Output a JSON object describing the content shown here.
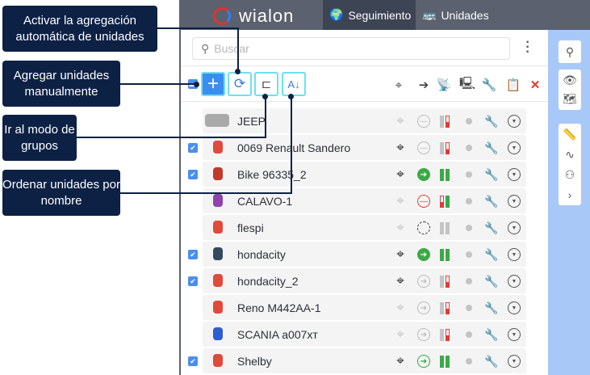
{
  "header": {
    "logo_text": "wialon",
    "tabs": [
      {
        "label": "Seguimiento",
        "icon": "globe-icon",
        "active": true
      },
      {
        "label": "Unidades",
        "icon": "bus-icon",
        "active": false
      }
    ]
  },
  "search": {
    "placeholder": "Buscar",
    "value": ""
  },
  "toolbar": {
    "buttons": [
      {
        "name": "add-units",
        "icon": "plus-icon"
      },
      {
        "name": "auto-add",
        "icon": "refresh-icon"
      },
      {
        "name": "groups-mode",
        "icon": "tree-icon"
      },
      {
        "name": "sort-by-name",
        "icon": "sort-az-icon",
        "label": "A↓"
      }
    ],
    "column_icons": [
      "crosshair-icon",
      "arrow-circle-icon",
      "satellite-icon",
      "network-icon",
      "wrench-icon",
      "clipboard-icon",
      "close-icon"
    ]
  },
  "units": [
    {
      "name": "JEEP",
      "checked": false,
      "icon_color": "#aaaaaa",
      "crosshair": "dim",
      "status": "stop-gray",
      "bars": [
        "gray",
        "red-low"
      ]
    },
    {
      "name": "0069 Renault Sandero",
      "checked": true,
      "icon_color": "#e04a3a",
      "crosshair": "on",
      "status": "stop-gray",
      "bars": [
        "gray",
        "red-low"
      ]
    },
    {
      "name": "Bike 96335_2",
      "checked": true,
      "icon_color": "#c0392b",
      "crosshair": "on",
      "status": "move-green",
      "bars": [
        "green",
        "green"
      ]
    },
    {
      "name": "CALAVO-1",
      "checked": false,
      "icon_color": "#8e44ad",
      "crosshair": "dim",
      "status": "stop-red",
      "bars": [
        "red-low",
        "green"
      ]
    },
    {
      "name": "flespi",
      "checked": false,
      "icon_color": "#e04a3a",
      "crosshair": "dim",
      "status": "none",
      "bars": [
        "gray",
        "gray"
      ]
    },
    {
      "name": "hondacity",
      "checked": true,
      "icon_color": "#34495e",
      "crosshair": "on",
      "status": "move-green",
      "bars": [
        "green",
        "green"
      ]
    },
    {
      "name": "hondacity_2",
      "checked": true,
      "icon_color": "#e04a3a",
      "crosshair": "on",
      "status": "arrow-gray",
      "bars": [
        "gray",
        "red-low"
      ]
    },
    {
      "name": "Reno M442AA-1",
      "checked": false,
      "icon_color": "#e04a3a",
      "crosshair": "dim",
      "status": "arrow-gray",
      "bars": [
        "gray",
        "red-low"
      ]
    },
    {
      "name": "SCANIA a007xт",
      "checked": false,
      "icon_color": "#2d5fd0",
      "crosshair": "dim",
      "status": "arrow-gray",
      "bars": [
        "gray",
        "red-low"
      ]
    },
    {
      "name": "Shelby",
      "checked": true,
      "icon_color": "#e04a3a",
      "crosshair": "on",
      "status": "arrow-green",
      "bars": [
        "green",
        "green"
      ]
    }
  ],
  "callouts": {
    "auto_add": "Activar la agregación automática de unidades",
    "add_manual": "Agregar unidades manualmente",
    "groups": "Ir al modo de grupos",
    "sort": "Ordenar unidades por nombre"
  },
  "colors": {
    "header": "#5b616e",
    "accent": "#3a8ef0",
    "callout": "#0d2145",
    "highlight": "#6ee0f0",
    "map": "#a8c8f8"
  }
}
